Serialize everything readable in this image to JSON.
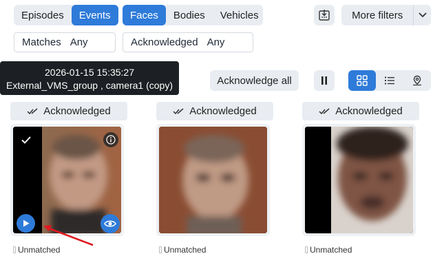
{
  "type_tabs": [
    {
      "label": "Episodes",
      "active": false
    },
    {
      "label": "Events",
      "active": true
    }
  ],
  "object_tabs": [
    {
      "label": "Faces",
      "active": true
    },
    {
      "label": "Bodies",
      "active": false
    },
    {
      "label": "Vehicles",
      "active": false
    }
  ],
  "more_filters": {
    "label": "More filters"
  },
  "filters": {
    "matches": {
      "label": "Matches",
      "value": "Any"
    },
    "acknowledged": {
      "label": "Acknowledged",
      "value": "Any"
    }
  },
  "toolbar": {
    "acknowledge_all": "Acknowledge all"
  },
  "tooltip": {
    "line1": "2026-01-15 15:35:27",
    "line2": "External_VMS_group , camera1 (copy)"
  },
  "cards": [
    {
      "ack_label": "Acknowledged",
      "status": "Unmatched"
    },
    {
      "ack_label": "Acknowledged",
      "status": "Unmatched"
    },
    {
      "ack_label": "Acknowledged",
      "status": "Unmatched"
    }
  ],
  "colors": {
    "accent": "#2e7bd9",
    "arrow": "#e0191f",
    "tooltip_bg": "#1c1f23"
  }
}
